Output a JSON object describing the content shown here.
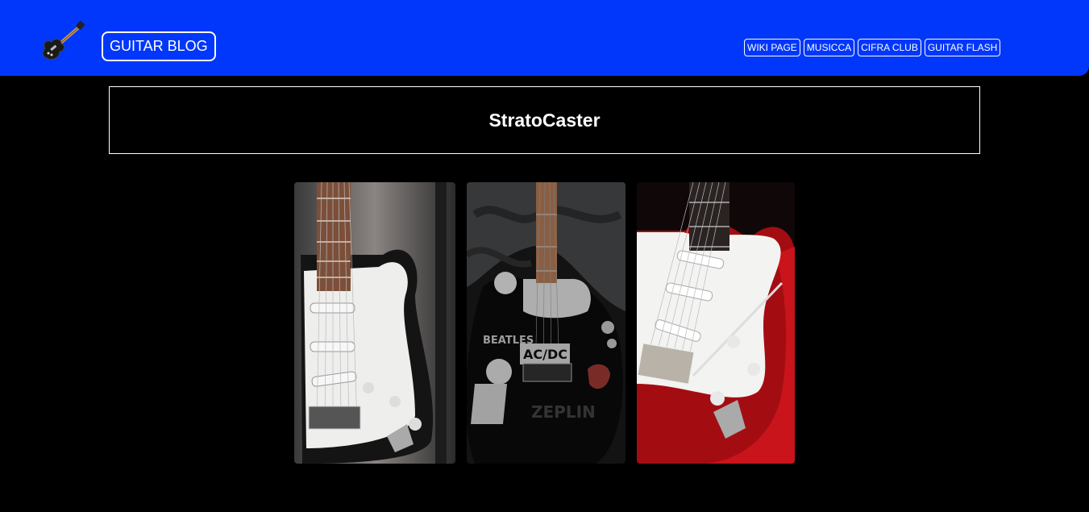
{
  "header": {
    "logo_icon": "electric-guitar-icon",
    "brand_label": "GUITAR BLOG",
    "nav": [
      {
        "label": "WIKI PAGE"
      },
      {
        "label": "MUSICCA"
      },
      {
        "label": "CIFRA CLUB"
      },
      {
        "label": "GUITAR FLASH"
      }
    ]
  },
  "main": {
    "title": "StratoCaster"
  },
  "gallery": [
    {
      "image": "white-stratocaster-photo"
    },
    {
      "image": "black-stickered-guitar-photo"
    },
    {
      "image": "red-stratocaster-photo"
    }
  ],
  "colors": {
    "header_bg": "#0037fb",
    "page_bg": "#000000",
    "text": "#ffffff"
  }
}
